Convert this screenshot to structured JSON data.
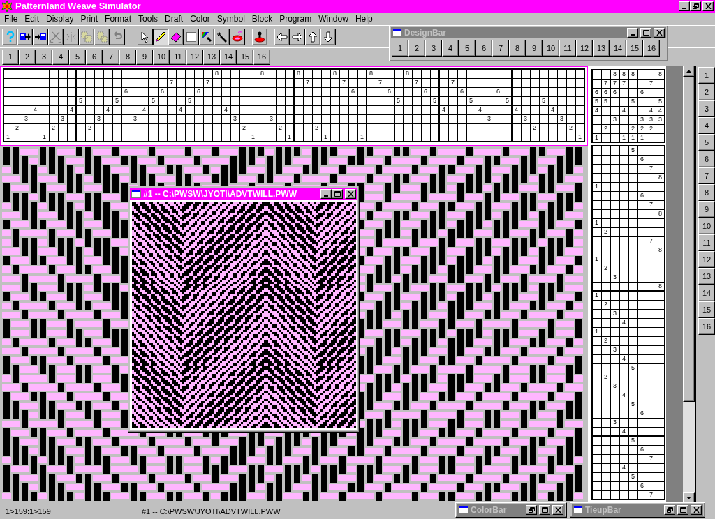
{
  "window": {
    "title": "Patternland Weave Simulator"
  },
  "menu": [
    "File",
    "Edit",
    "Display",
    "Print",
    "Format",
    "Tools",
    "Draft",
    "Color",
    "Symbol",
    "Block",
    "Program",
    "Window",
    "Help"
  ],
  "edit_tools": [
    {
      "disabled": false
    },
    {
      "disabled": false
    },
    {
      "disabled": false
    },
    {
      "disabled": true
    },
    {
      "disabled": true
    },
    {
      "disabled": true
    },
    {
      "disabled": true
    },
    {
      "disabled": true
    }
  ],
  "draw_tools": [
    {
      "selected": false
    },
    {
      "selected": true
    },
    {
      "selected": false
    },
    {
      "selected": false
    },
    {
      "selected": false
    },
    {
      "selected": false
    },
    {
      "selected": false
    }
  ],
  "color_bar": [
    "1",
    "2",
    "3",
    "4",
    "5",
    "6",
    "7",
    "8",
    "9",
    "10",
    "11",
    "12",
    "13",
    "14",
    "15",
    "16"
  ],
  "design_bar": {
    "title": "DesignBar",
    "buttons": [
      "1",
      "2",
      "3",
      "4",
      "5",
      "6",
      "7",
      "8",
      "9",
      "10",
      "11",
      "12",
      "13",
      "14",
      "15",
      "16"
    ]
  },
  "threading": [
    "1",
    "2",
    "3",
    "4",
    "1",
    "2",
    "3",
    "4",
    "5",
    "2",
    "3",
    "4",
    "5",
    "6",
    "3",
    "4",
    "5",
    "6",
    "7",
    "4",
    "5",
    "6",
    "7",
    "8",
    "4",
    "3",
    "2",
    "1",
    "8",
    "3",
    "2",
    "1",
    "8",
    "7",
    "2",
    "1",
    "8",
    "7",
    "6",
    "1",
    "8",
    "7",
    "6",
    "5",
    "8",
    "7",
    "6",
    "5",
    "4",
    "7",
    "6",
    "5",
    "4",
    "3",
    "6",
    "5",
    "4",
    "3",
    "2",
    "5",
    "4",
    "3",
    "2",
    "1"
  ],
  "tieup": [
    [
      "6",
      "5",
      "4",
      "1"
    ],
    [
      "7",
      "6",
      "5",
      "2"
    ],
    [
      "8",
      "7",
      "6",
      "3"
    ],
    [
      "8",
      "7",
      "4",
      "1"
    ],
    [
      "8",
      "5",
      "2",
      "1"
    ],
    [
      "6",
      "3",
      "2",
      "1"
    ],
    [
      "7",
      "4",
      "3",
      "2"
    ],
    [
      "8",
      "5",
      "4",
      "3"
    ]
  ],
  "treadling": [
    "5",
    "6",
    "7",
    "8",
    "1",
    "6",
    "7",
    "8",
    "1",
    "2",
    "7",
    "8",
    "1",
    "2",
    "3",
    "8",
    "1",
    "2",
    "3",
    "4",
    "1",
    "2",
    "3",
    "4",
    "5",
    "2",
    "3",
    "4",
    "5",
    "6",
    "3",
    "4",
    "5",
    "6",
    "7",
    "4",
    "5",
    "6",
    "7"
  ],
  "side_bar": [
    "1",
    "2",
    "3",
    "4",
    "5",
    "6",
    "7",
    "8",
    "9",
    "10",
    "11",
    "12",
    "13",
    "14",
    "15",
    "16"
  ],
  "document_window": {
    "title": "#1 -- C:\\PWSW\\JYOTI\\ADVTWILL.PWW"
  },
  "status_bar": {
    "range": "1>159:1>159",
    "file": "#1 -- C:\\PWSW\\JYOTI\\ADVTWILL.PWW"
  },
  "minimized_windows": [
    {
      "title": "ColorBar"
    },
    {
      "title": "TieupBar"
    }
  ]
}
